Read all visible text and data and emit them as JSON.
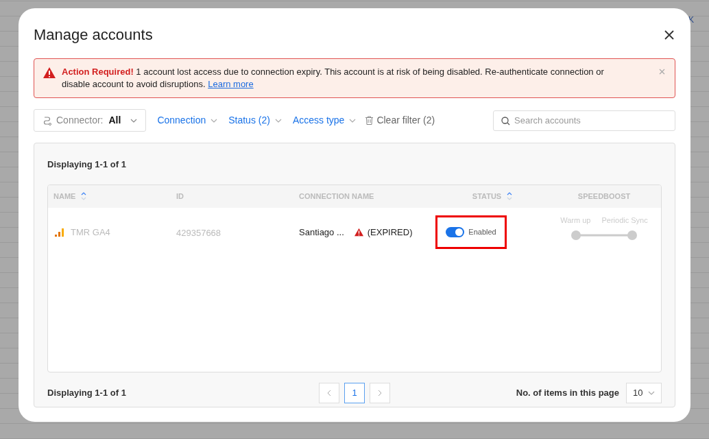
{
  "background": {
    "corner_text": "K"
  },
  "dialog": {
    "title": "Manage accounts"
  },
  "alert": {
    "heading": "Action Required!",
    "message": "1 account lost access due to connection expiry. This account is at risk of being disabled. Re-authenticate connection or disable account to avoid disruptions.",
    "link": "Learn more"
  },
  "filters": {
    "connector": {
      "label": "Connector:",
      "value": "All"
    },
    "dropdowns": [
      {
        "label": "Connection"
      },
      {
        "label": "Status (2)"
      },
      {
        "label": "Access type"
      }
    ],
    "clear": "Clear filter (2)",
    "search": {
      "placeholder": "Search accounts"
    }
  },
  "summary_top": "Displaying 1-1 of 1",
  "table": {
    "columns": [
      {
        "label": "NAME",
        "sortable": true
      },
      {
        "label": "ID",
        "sortable": false
      },
      {
        "label": "CONNECTION NAME",
        "sortable": false
      },
      {
        "label": "STATUS",
        "sortable": true
      },
      {
        "label": "SPEEDBOOST",
        "sortable": false
      }
    ],
    "rows": [
      {
        "name": "TMR GA4",
        "id": "429357668",
        "connection": "Santiago ...",
        "connection_status": "(EXPIRED)",
        "enabled": true,
        "status_label": "Enabled",
        "highlighted": true,
        "speedboost": {
          "stops": [
            "Warm up",
            "Periodic Sync"
          ],
          "disabled": true
        }
      }
    ]
  },
  "footer": {
    "summary": "Displaying 1-1 of 1",
    "pages": [
      {
        "label": "1",
        "selected": true
      }
    ],
    "per_page_label": "No. of items in this page",
    "per_page": "10"
  }
}
